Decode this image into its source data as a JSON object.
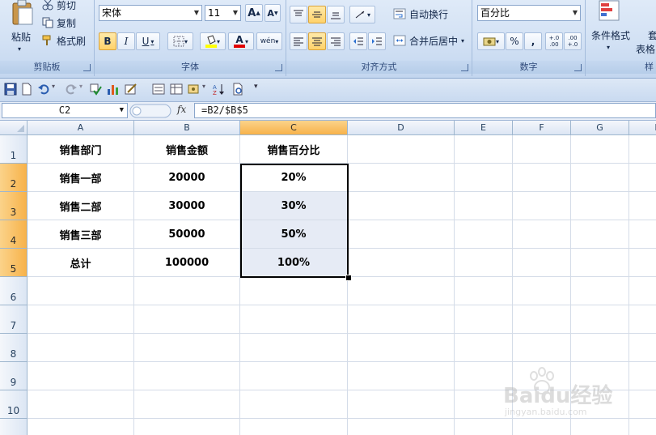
{
  "ribbon": {
    "clipboard": {
      "paste_label": "粘贴",
      "cut_label": "剪切",
      "copy_label": "复制",
      "format_painter_label": "格式刷",
      "group_label": "剪贴板"
    },
    "font": {
      "font_name": "宋体",
      "font_size": "11",
      "bold": "B",
      "italic": "I",
      "underline": "U",
      "font_color_glyph": "A",
      "phonetic_glyph": "wén",
      "grow_glyph": "A",
      "shrink_glyph": "A",
      "group_label": "字体"
    },
    "alignment": {
      "wrap_text_label": "自动换行",
      "merge_center_label": "合并后居中",
      "group_label": "对齐方式"
    },
    "number": {
      "format": "百分比",
      "percent": "%",
      "comma": ",",
      "increase_decimal": "+.0 .00",
      "decrease_decimal": ".00 +.0",
      "group_label": "数字"
    },
    "styles": {
      "conditional_formatting_label": "条件格式",
      "format_as_table_label_line1": "套",
      "format_as_table_label_line2": "表格",
      "group_label": "样"
    }
  },
  "formula_bar": {
    "name_box": "C2",
    "fx": "fx",
    "formula": "=B2/$B$5"
  },
  "grid": {
    "columns": [
      "A",
      "B",
      "C",
      "D",
      "E",
      "F",
      "G",
      "H"
    ],
    "rows": [
      "1",
      "2",
      "3",
      "4",
      "5",
      "6",
      "7",
      "8",
      "9",
      "10"
    ],
    "selected_column": "C",
    "selected_rows": [
      "2",
      "3",
      "4",
      "5"
    ],
    "cells": {
      "A1": "销售部门",
      "B1": "销售金额",
      "C1": "销售百分比",
      "A2": "销售一部",
      "B2": "20000",
      "C2": "20%",
      "A3": "销售二部",
      "B3": "30000",
      "C3": "30%",
      "A4": "销售三部",
      "B4": "50000",
      "C4": "50%",
      "A5": "总计",
      "B5": "100000",
      "C5": "100%"
    }
  },
  "colors": {
    "selection_header": "#f7b24a",
    "selection_fill": "#e6ebf5",
    "ribbon": "#d2e1f4"
  },
  "watermark": {
    "logo": "Baidu经验",
    "url": "jingyan.baidu.com"
  }
}
